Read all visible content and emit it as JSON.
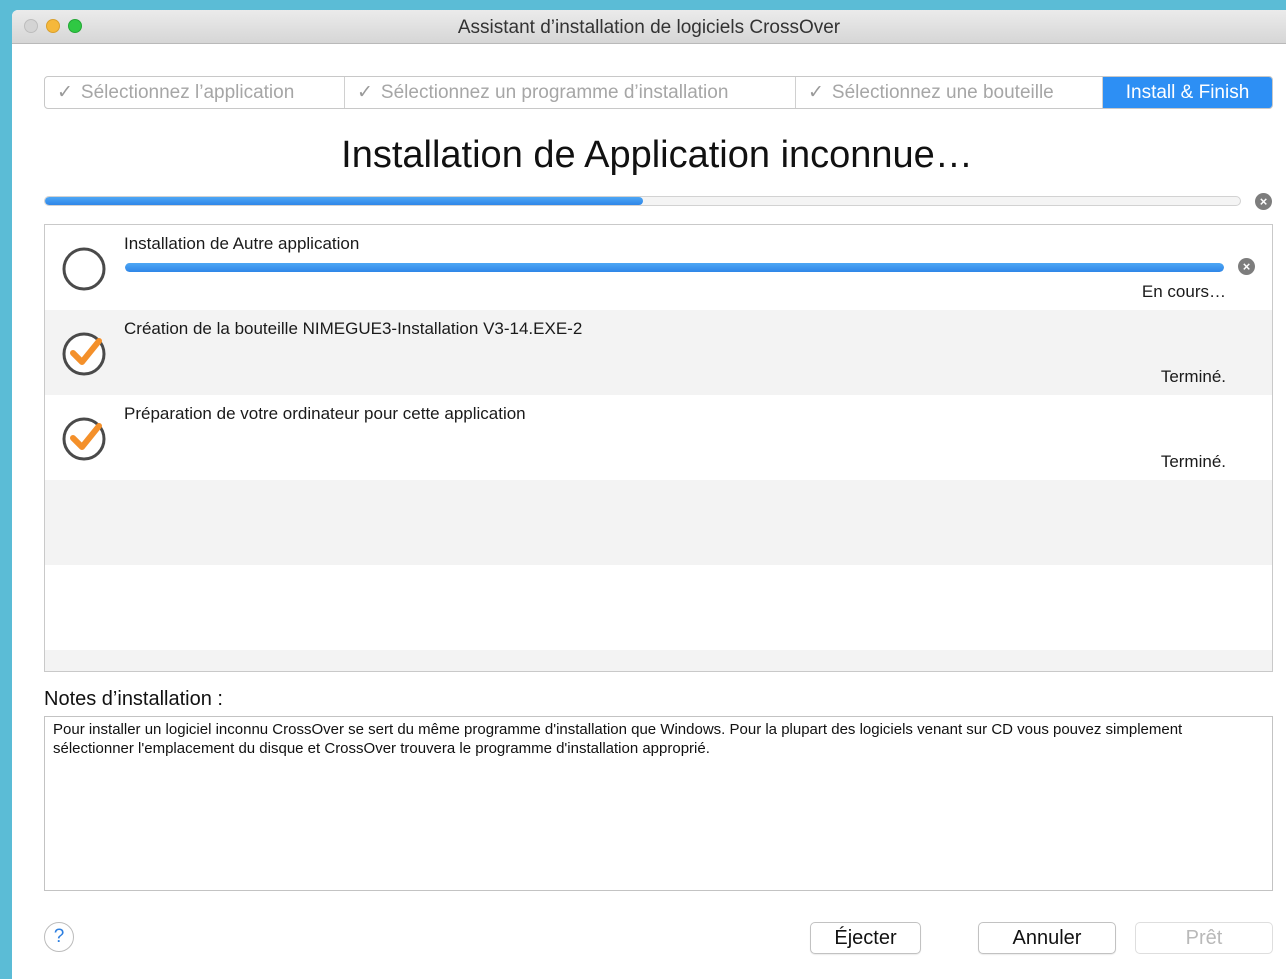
{
  "window": {
    "title": "Assistant d’installation de logiciels CrossOver"
  },
  "steps": [
    {
      "label": "Sélectionnez l’application",
      "done": true
    },
    {
      "label": "Sélectionnez un programme d’installation",
      "done": true
    },
    {
      "label": "Sélectionnez une bouteille",
      "done": true
    },
    {
      "label": "Install & Finish",
      "active": true
    }
  ],
  "heading": "Installation de Application inconnue…",
  "overall_progress": 0.5,
  "tasks": [
    {
      "label": "Installation de Autre application",
      "status": "En cours…",
      "state": "in-progress",
      "progress": 1.0
    },
    {
      "label": "Création de la bouteille NIMEGUE3-Installation V3-14.EXE-2",
      "status": "Terminé.",
      "state": "done"
    },
    {
      "label": "Préparation de votre ordinateur pour cette application",
      "status": "Terminé.",
      "state": "done"
    }
  ],
  "notes": {
    "label": "Notes d’installation :",
    "text": "Pour installer un logiciel inconnu CrossOver se sert du même programme d'installation que Windows. Pour la plupart des logiciels venant sur CD vous pouvez simplement sélectionner l'emplacement du disque et CrossOver trouvera le programme d'installation approprié."
  },
  "buttons": {
    "help": "?",
    "eject": "Éjecter",
    "cancel": "Annuler",
    "ready": "Prêt"
  },
  "colors": {
    "accent": "#2d8ff4",
    "check_orange": "#f4902a"
  }
}
